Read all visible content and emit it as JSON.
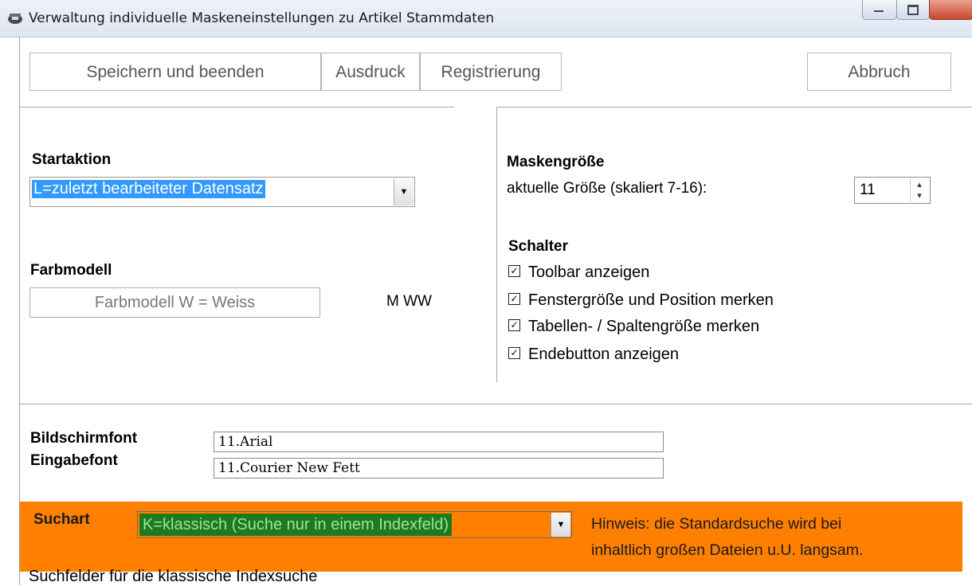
{
  "window": {
    "title": "Verwaltung individuelle Maskeneinstellungen zu Artikel Stammdaten",
    "icon": "app-icon"
  },
  "toolbar": {
    "save_label": "Speichern und beenden",
    "print_label": "Ausdruck",
    "register_label": "Registrierung",
    "cancel_label": "Abbruch"
  },
  "startaktion": {
    "label": "Startaktion",
    "selected": "L=zuletzt bearbeiteter Datensatz"
  },
  "farbmodell": {
    "label": "Farbmodell",
    "button_label": "Farbmodell W = Weiss",
    "code": "M WW"
  },
  "maskengroesse": {
    "label": "Maskengröße",
    "size_label": "aktuelle Größe (skaliert 7-16):",
    "size_value": "11"
  },
  "schalter": {
    "label": "Schalter",
    "items": [
      {
        "label": "Toolbar anzeigen",
        "checked": true
      },
      {
        "label": "Fenstergröße und Position merken",
        "checked": true
      },
      {
        "label": "Tabellen- / Spaltengröße merken",
        "checked": true
      },
      {
        "label": "Endebutton anzeigen",
        "checked": true
      }
    ]
  },
  "fonts": {
    "screen_label": "Bildschirmfont",
    "screen_value": "11.Arial",
    "input_label": "Eingabefont",
    "input_value": "11.Courier New Fett"
  },
  "suchart": {
    "label": "Suchart",
    "selected": "K=klassisch (Suche nur in einem Indexfeld)",
    "hint_line1": "Hinweis: die Standardsuche wird bei",
    "hint_line2": "inhaltlich großen Dateien u.U. langsam."
  },
  "suchfelder_label": "Suchfelder für die klassische Indexsuche",
  "colors": {
    "accent_orange": "#ff8000",
    "selection_blue": "#3399ff",
    "selection_green": "#1e7a1e"
  }
}
